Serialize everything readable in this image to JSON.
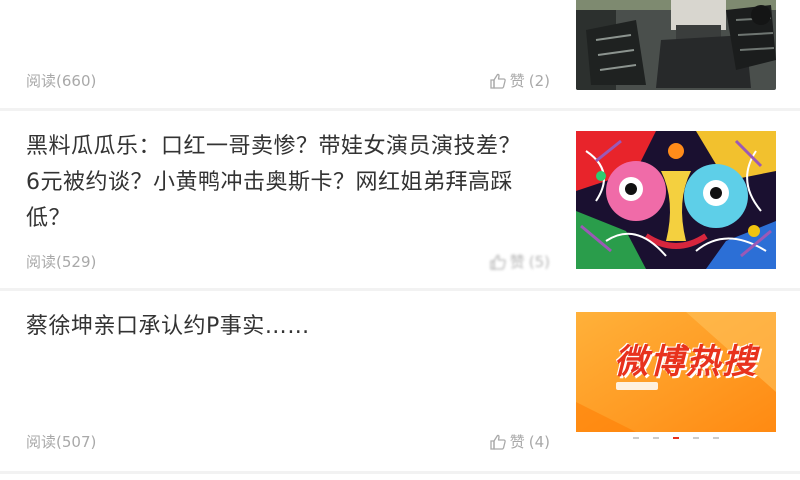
{
  "articles": [
    {
      "title": "",
      "read_label": "阅读",
      "read_count": "(660)",
      "like_label": "赞",
      "like_count": "(2)",
      "image": "vehicle-photo"
    },
    {
      "title": "黑料瓜瓜乐：口红一哥卖惨？带娃女演员演技差？6元被约谈？小黄鸭冲击奥斯卡？网红姐弟拜高踩低？",
      "read_label": "阅读",
      "read_count": "(529)",
      "like_label": "赞",
      "like_count": "(5)",
      "image": "colorful-face-illustration"
    },
    {
      "title": "蔡徐坤亲口承认约P事实……",
      "read_label": "阅读",
      "read_count": "(507)",
      "like_label": "赞",
      "like_count": "(4)",
      "image": "weibo-hot-search-banner"
    }
  ],
  "weibo_banner": {
    "text": "微博热搜",
    "tabs": [
      "",
      "",
      "",
      "",
      ""
    ]
  },
  "icons": {
    "like": "thumbs-up-icon"
  },
  "colors": {
    "title": "#333333",
    "meta": "#a9a9a9",
    "divider": "#f2f2f2",
    "banner_orange": "#ff9a1f",
    "banner_red": "#e8321d"
  }
}
